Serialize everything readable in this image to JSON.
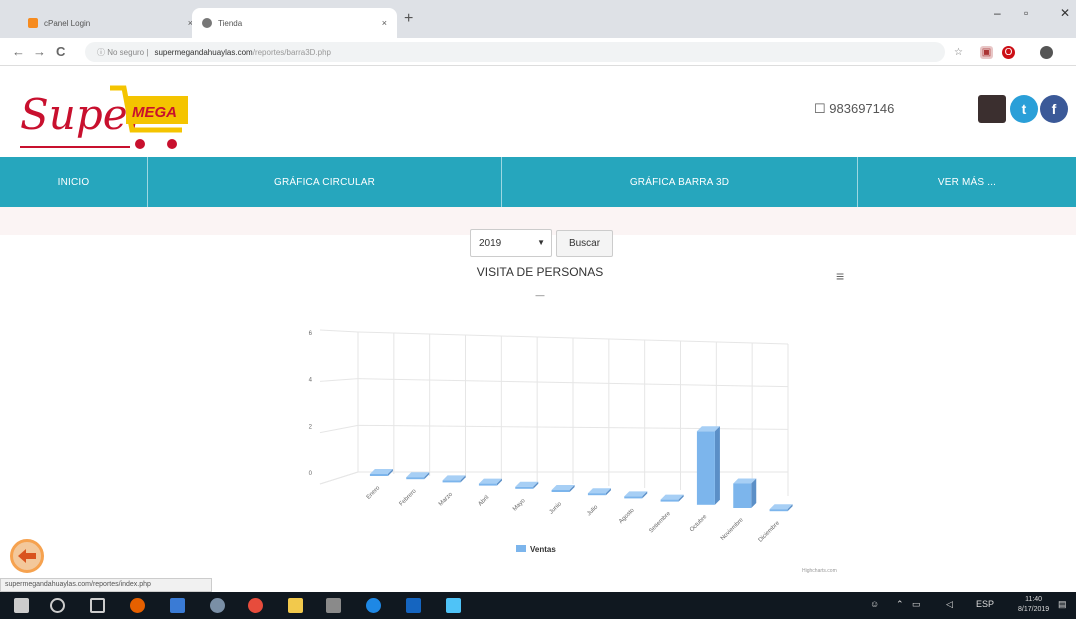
{
  "browser": {
    "tabs": [
      {
        "title": "cPanel Login",
        "close": "×"
      },
      {
        "title": "Tienda",
        "close": "×"
      }
    ],
    "new_tab": "+",
    "window_controls": [
      "–",
      "▫",
      "✕"
    ],
    "nav": {
      "back": "←",
      "forward": "→",
      "reload": "C"
    },
    "address": {
      "security": "ⓘ No seguro |",
      "host": "supermegandahuaylas.com",
      "path": "/reportes/barra3D.php"
    }
  },
  "header": {
    "logo_text": "Super",
    "logo_badge": "MEGA",
    "phone_icon": "☐",
    "phone": "983697146",
    "social": [
      "instagram-icon",
      "twitter-icon",
      "facebook-icon"
    ]
  },
  "nav": {
    "items": [
      "INICIO",
      "GRÁFICA CIRCULAR",
      "GRÁFICA BARRA 3D",
      "VER MÁS ..."
    ]
  },
  "controls": {
    "year": "2019",
    "search_label": "Buscar"
  },
  "chart_data": {
    "type": "bar",
    "title": "VISITA DE PERSONAS",
    "subtitle": "—",
    "categories": [
      "Enero",
      "Febrero",
      "Marzo",
      "Abril",
      "Mayo",
      "Junio",
      "Julio",
      "Agosto",
      "Setiembre",
      "Octubre",
      "Noviembre",
      "Diciembre"
    ],
    "series": [
      {
        "name": "Ventas",
        "values": [
          0,
          0,
          0,
          0,
          0,
          0,
          0,
          0,
          0,
          3,
          1,
          0
        ]
      }
    ],
    "yticks": [
      "0",
      "2",
      "4",
      "6"
    ],
    "ylim": [
      0,
      6
    ],
    "grid": true,
    "legend": "bottom-center",
    "credits": "Highcharts.com",
    "bar_color": "#7cb5ec",
    "menu_icon": "≡"
  },
  "status": {
    "url": "supermegandahuaylas.com/reportes/index.php"
  },
  "taskbar": {
    "time": "11:40",
    "date": "8/17/2019",
    "lang": "ESP"
  }
}
